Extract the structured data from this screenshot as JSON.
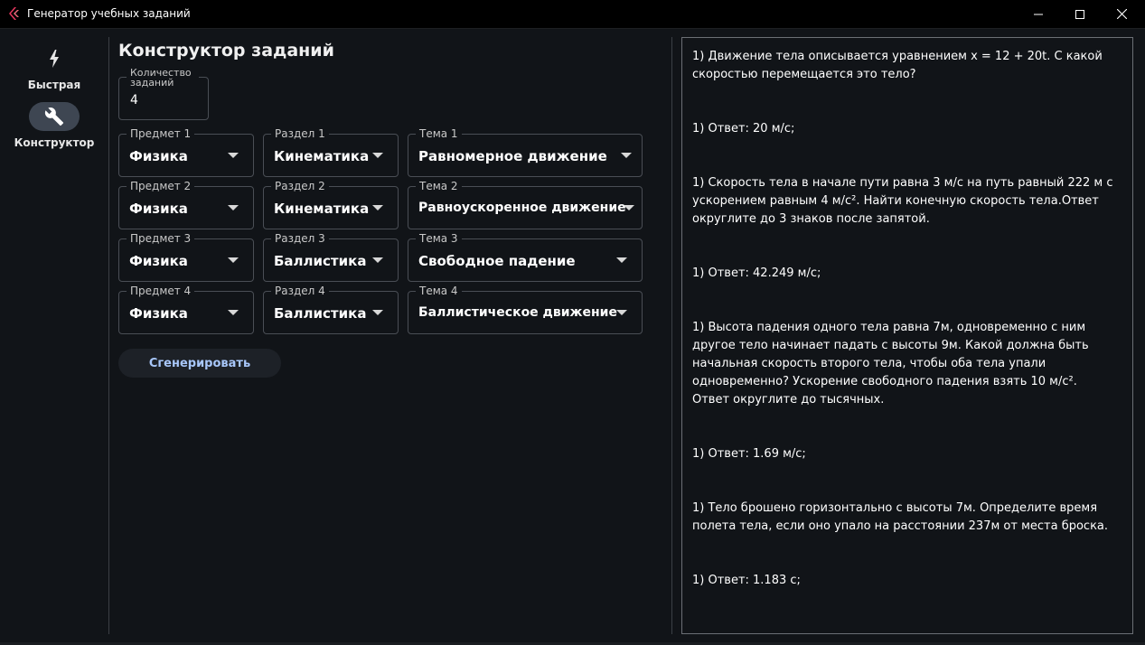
{
  "window": {
    "title": "Генератор учебных заданий"
  },
  "colors": {
    "accent": "#a8c7fa",
    "selected_rail": "#3e4652",
    "background": "#111418",
    "titlebar": "#000000",
    "app_icon": "#e8365d"
  },
  "rail": {
    "items": [
      {
        "label": "Быстрая",
        "icon": "bolt-icon",
        "selected": false
      },
      {
        "label": "Конструктор",
        "icon": "wrench-icon",
        "selected": true
      }
    ]
  },
  "main": {
    "title": "Конструктор заданий",
    "count": {
      "label": "Количество заданий",
      "value": "4"
    },
    "rows": [
      {
        "subject_label": "Предмет 1",
        "subject": "Физика",
        "section_label": "Раздел 1",
        "section": "Кинематика",
        "topic_label": "Тема 1",
        "topic": "Равномерное движение"
      },
      {
        "subject_label": "Предмет 2",
        "subject": "Физика",
        "section_label": "Раздел 2",
        "section": "Кинематика",
        "topic_label": "Тема 2",
        "topic": "Равноускоренное движение"
      },
      {
        "subject_label": "Предмет 3",
        "subject": "Физика",
        "section_label": "Раздел 3",
        "section": "Баллистика",
        "topic_label": "Тема 3",
        "topic": "Свободное падение"
      },
      {
        "subject_label": "Предмет 4",
        "subject": "Физика",
        "section_label": "Раздел 4",
        "section": "Баллистика",
        "topic_label": "Тема 4",
        "topic": "Баллистическое движение"
      }
    ],
    "generate_label": "Сгенерировать"
  },
  "output": {
    "blocks": [
      "1) Движение тела описывается уравнением x = 12 + 20t. С какой скоростью перемещается это тело?",
      "1) Ответ: 20 м/с;",
      "1) Скорость тела в начале пути равна 3 м/с на путь равный 222 м с ускорением равным 4 м/с². Найти конечную скорость тела.Ответ округлите до 3 знаков после запятой.",
      "1) Ответ: 42.249 м/с;",
      "1) Высота падения одного тела равна 7м, одновременно с ним другое тело начинает падать с высоты 9м. Какой должна быть начальная скорость второго тела, чтобы оба тела упали одновременно? Ускорение свободного падения взять 10 м/с². Ответ округлите до тысячных.",
      "1) Ответ: 1.69 м/с;",
      "1) Тело брошено горизонтально с высоты 7м. Определите время полета тела, если оно упало на расстоянии 237м от места броска.",
      "1) Ответ: 1.183 с;"
    ]
  }
}
